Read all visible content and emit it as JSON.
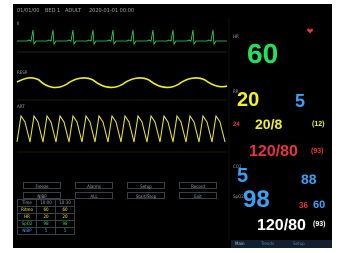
{
  "topbar": {
    "left": "01/01/00",
    "mid1": "BED 1",
    "mid2": "ADULT",
    "time": "2020-01-01 00:00"
  },
  "waves": {
    "ecg_label": "II",
    "resp_label": "RESP",
    "art_label": "ART"
  },
  "vitals": {
    "hr": "60",
    "hr_label": "HR",
    "rr": "20",
    "rr_label": "RR",
    "rr_secondary": "5",
    "pap": "20/8",
    "pap_mean": "(12)",
    "nibp": "120/80",
    "nibp_mean": "(93)",
    "small_red": "24",
    "etco2": "5",
    "etco2_label": "CO2",
    "temp": "88",
    "spo2": "98",
    "spo2_label": "SpO2",
    "pulse_red": "36",
    "pulse_blue": "60",
    "art": "120/80",
    "art_mean": "(93)"
  },
  "controls": {
    "b1": "Freeze",
    "b2": "Alarms",
    "b3": "Setup",
    "b4": "Record",
    "b5": "NIBP",
    "b6": "ALL",
    "b7": "Start/Stop",
    "b8": "Exit"
  },
  "trend_table": {
    "headers": [
      "Time",
      "10:00",
      "10:30"
    ],
    "rows": [
      [
        "Ritmo",
        "60",
        "60"
      ],
      [
        "HR",
        "20",
        "20"
      ],
      [
        "SpO2",
        "98",
        "98"
      ],
      [
        "NIBP",
        "5",
        "5"
      ]
    ]
  },
  "bottombar": {
    "a": "Main",
    "b": "Trends",
    "c": "Setup"
  },
  "colors": {
    "green": "#22e05a",
    "yellow": "#f2ef22",
    "red": "#e8343c",
    "blue": "#3aa2f5",
    "white": "#ffffff",
    "bg": "#000000"
  }
}
